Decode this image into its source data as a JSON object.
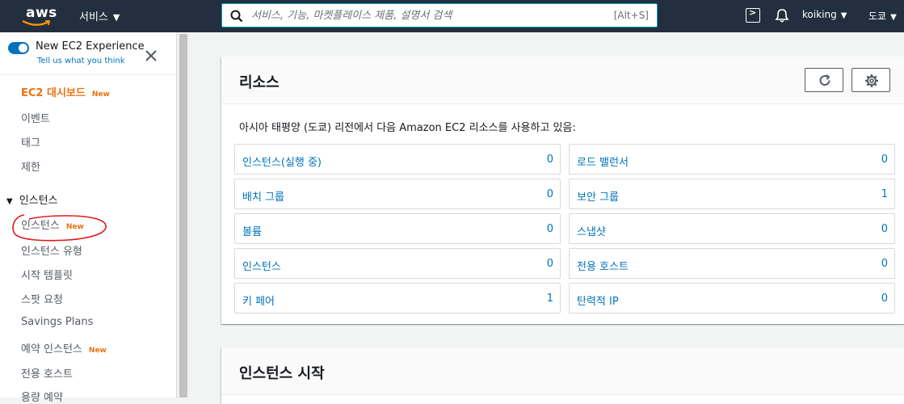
{
  "topnav": {
    "logo_text": "aws",
    "services_label": "서비스",
    "search_placeholder": "서비스, 기능, 마켓플레이스 제품, 설명서 검색",
    "search_shortcut": "[Alt+S]",
    "user_name": "koiking",
    "region": "도쿄"
  },
  "sidebar": {
    "experience_title": "New EC2 Experience",
    "experience_sub": "Tell us what you think",
    "items": [
      {
        "label": "EC2 대시보드",
        "badge": "New"
      },
      {
        "label": "이벤트"
      },
      {
        "label": "태그"
      },
      {
        "label": "제한"
      }
    ],
    "section": {
      "title": "인스턴스",
      "items": [
        {
          "label": "인스턴스",
          "badge": "New"
        },
        {
          "label": "인스턴스 유형"
        },
        {
          "label": "시작 템플릿"
        },
        {
          "label": "스팟 요청"
        },
        {
          "label": "Savings Plans"
        },
        {
          "label": "예약 인스턴스",
          "badge": "New"
        },
        {
          "label": "전용 호스트"
        },
        {
          "label": "용량 예약"
        }
      ]
    }
  },
  "resources": {
    "title": "리소스",
    "description": "아시아 태평양 (도쿄) 리전에서 다음 Amazon EC2 리소스를 사용하고 있음:",
    "left": [
      {
        "label": "인스턴스(실행 중)",
        "count": "0"
      },
      {
        "label": "배치 그룹",
        "count": "0"
      },
      {
        "label": "볼륨",
        "count": "0"
      },
      {
        "label": "인스턴스",
        "count": "0"
      },
      {
        "label": "키 페어",
        "count": "1"
      }
    ],
    "right": [
      {
        "label": "로드 밸런서",
        "count": "0"
      },
      {
        "label": "보안 그룹",
        "count": "1"
      },
      {
        "label": "스냅샷",
        "count": "0"
      },
      {
        "label": "전용 호스트",
        "count": "0"
      },
      {
        "label": "탄력적 IP",
        "count": "0"
      }
    ]
  },
  "launch": {
    "title": "인스턴스 시작"
  },
  "colors": {
    "nav_bg": "#232f3e",
    "link": "#0073bb",
    "active": "#ec7211",
    "annotation": "#e0161b"
  }
}
